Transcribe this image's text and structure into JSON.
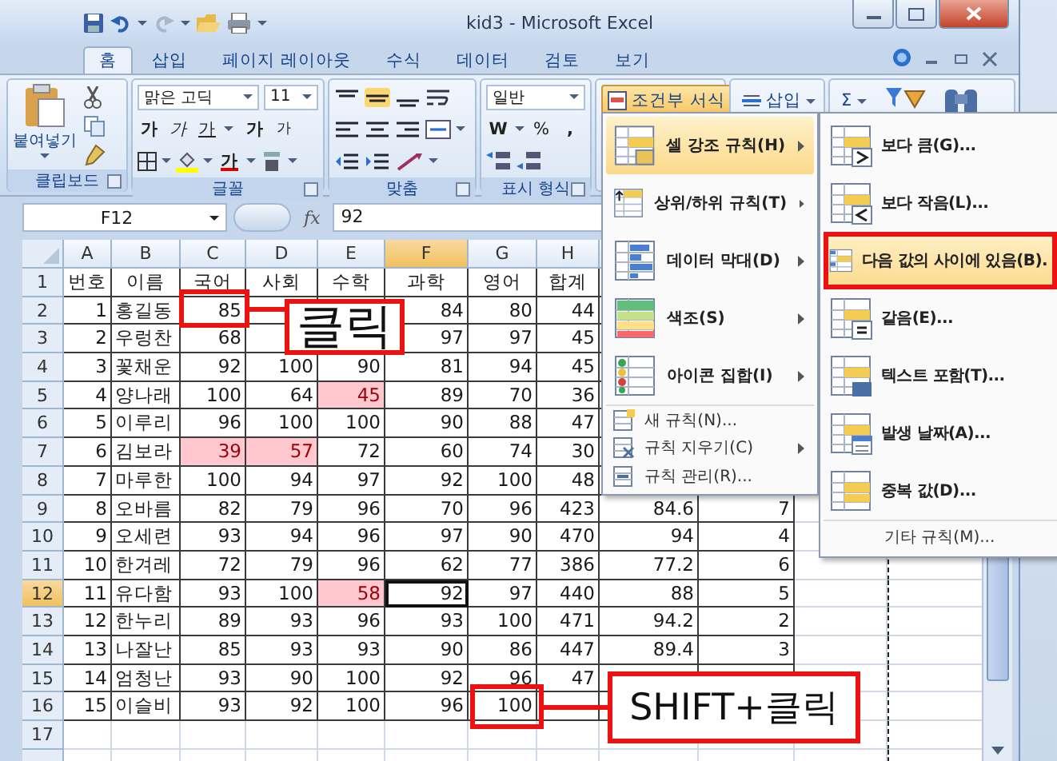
{
  "window": {
    "title": "kid3 - Microsoft Excel"
  },
  "tabs": [
    {
      "label": "홈",
      "selected": true
    },
    {
      "label": "삽입",
      "selected": false
    },
    {
      "label": "페이지 레이아웃",
      "selected": false
    },
    {
      "label": "수식",
      "selected": false
    },
    {
      "label": "데이터",
      "selected": false
    },
    {
      "label": "검토",
      "selected": false
    },
    {
      "label": "보기",
      "selected": false
    }
  ],
  "ribbon": {
    "clipboard": {
      "label": "클립보드",
      "paste": "붙여넣기"
    },
    "font": {
      "label": "글꼴",
      "family": "맑은 고딕",
      "size": "11",
      "bold": "가",
      "italic": "가",
      "underline": "가",
      "grow": "가",
      "shrink": "가",
      "text_color_button": "가"
    },
    "alignment": {
      "label": "맞춤"
    },
    "number": {
      "label": "표시 형식",
      "format": "일반",
      "currency": "W",
      "percent": "%",
      "comma": ","
    },
    "styles": {
      "conditional": "조건부 서식",
      "pressed": true
    },
    "cells": {
      "insert": "삽입"
    },
    "editing": {
      "sum": "Σ"
    }
  },
  "formula_bar": {
    "name_box": "F12",
    "fx": "fx",
    "value": "92"
  },
  "sheet": {
    "columns": [
      {
        "label": "A",
        "selected": false
      },
      {
        "label": "B",
        "selected": false
      },
      {
        "label": "C",
        "selected": false
      },
      {
        "label": "D",
        "selected": false
      },
      {
        "label": "E",
        "selected": false
      },
      {
        "label": "F",
        "selected": true
      },
      {
        "label": "G",
        "selected": false
      },
      {
        "label": "H",
        "selected": false
      }
    ],
    "rows": [
      {
        "header": "1",
        "selected": false,
        "kind": "heading",
        "cells": [
          "번호",
          "이름",
          "국어",
          "사회",
          "수학",
          "과학",
          "영어",
          "합계",
          null,
          null
        ]
      },
      {
        "header": "2",
        "selected": false,
        "kind": "data",
        "cells": [
          "1",
          "홍길동",
          "85",
          null,
          null,
          "84",
          "80",
          "44",
          null,
          null
        ]
      },
      {
        "header": "3",
        "selected": false,
        "kind": "data",
        "cells": [
          "2",
          "우렁찬",
          "68",
          null,
          null,
          "97",
          "97",
          "45",
          null,
          null
        ]
      },
      {
        "header": "4",
        "selected": false,
        "kind": "data",
        "cells": [
          "3",
          "꽃채운",
          "92",
          "100",
          "90",
          "81",
          "94",
          "45",
          null,
          null
        ]
      },
      {
        "header": "5",
        "selected": false,
        "kind": "data",
        "cells": [
          "4",
          "양나래",
          "100",
          "64",
          {
            "text": "45",
            "highlighted": true
          },
          "89",
          "70",
          "36",
          null,
          null
        ]
      },
      {
        "header": "6",
        "selected": false,
        "kind": "data",
        "cells": [
          "5",
          "이루리",
          "96",
          "100",
          "100",
          "90",
          "88",
          "47",
          null,
          null
        ]
      },
      {
        "header": "7",
        "selected": false,
        "kind": "data",
        "cells": [
          "6",
          "김보라",
          {
            "text": "39",
            "highlighted": true
          },
          {
            "text": "57",
            "highlighted": true
          },
          "72",
          "60",
          "74",
          "30",
          null,
          null
        ]
      },
      {
        "header": "8",
        "selected": false,
        "kind": "data",
        "cells": [
          "7",
          "마루한",
          "100",
          "94",
          "97",
          "92",
          "100",
          "48",
          null,
          null
        ]
      },
      {
        "header": "9",
        "selected": false,
        "kind": "data",
        "cells": [
          "8",
          "오바름",
          "82",
          "79",
          "96",
          "70",
          "96",
          "423",
          "84.6",
          "7"
        ]
      },
      {
        "header": "10",
        "selected": false,
        "kind": "data",
        "cells": [
          "9",
          "오세련",
          "93",
          "94",
          "96",
          "97",
          "90",
          "470",
          "94",
          "4"
        ]
      },
      {
        "header": "11",
        "selected": false,
        "kind": "data",
        "cells": [
          "10",
          "한겨레",
          "72",
          "79",
          "96",
          "62",
          "77",
          "386",
          "77.2",
          "6"
        ]
      },
      {
        "header": "12",
        "selected": true,
        "kind": "data",
        "cells": [
          "11",
          "유다함",
          "93",
          "100",
          {
            "text": "58",
            "highlighted": true
          },
          {
            "text": "92",
            "active": true
          },
          "97",
          "440",
          "88",
          "5"
        ]
      },
      {
        "header": "13",
        "selected": false,
        "kind": "data",
        "cells": [
          "12",
          "한누리",
          "89",
          "93",
          "96",
          "93",
          "100",
          "471",
          "94.2",
          "2"
        ]
      },
      {
        "header": "14",
        "selected": false,
        "kind": "data",
        "cells": [
          "13",
          "나잘난",
          "85",
          "93",
          "93",
          "90",
          "86",
          "447",
          "89.4",
          "3"
        ]
      },
      {
        "header": "15",
        "selected": false,
        "kind": "data",
        "cells": [
          "14",
          "엄청난",
          "93",
          "90",
          "100",
          "92",
          "96",
          "47",
          null,
          null
        ]
      },
      {
        "header": "16",
        "selected": false,
        "kind": "data",
        "cells": [
          "15",
          "이슬비",
          "93",
          "92",
          "100",
          "96",
          "100",
          null,
          null,
          null
        ]
      },
      {
        "header": "17",
        "selected": false,
        "kind": "empty"
      }
    ]
  },
  "menu": {
    "items": [
      {
        "label": "셀 강조 규칙(H)",
        "kind": "large",
        "selected": true,
        "has_submenu": true
      },
      {
        "label": "상위/하위 규칙(T)",
        "kind": "large",
        "selected": false,
        "has_submenu": true
      },
      {
        "label": "데이터 막대(D)",
        "kind": "large",
        "selected": false,
        "has_submenu": true
      },
      {
        "label": "색조(S)",
        "kind": "large",
        "selected": false,
        "has_submenu": true
      },
      {
        "label": "아이콘 집합(I)",
        "kind": "large",
        "selected": false,
        "has_submenu": true
      },
      {
        "label": "새 규칙(N)...",
        "kind": "small",
        "selected": false,
        "has_submenu": false
      },
      {
        "label": "규칙 지우기(C)",
        "kind": "small",
        "selected": false,
        "has_submenu": true
      },
      {
        "label": "규칙 관리(R)...",
        "kind": "small",
        "selected": false,
        "has_submenu": false
      }
    ]
  },
  "submenu": {
    "items": [
      {
        "label": "보다 큼(G)...",
        "kind": "large",
        "selected": false
      },
      {
        "label": "보다 작음(L)...",
        "kind": "large",
        "selected": false
      },
      {
        "label": "다음 값의 사이에 있음(B).",
        "kind": "large",
        "selected": true
      },
      {
        "label": "같음(E)...",
        "kind": "large",
        "selected": false
      },
      {
        "label": "텍스트 포함(T)...",
        "kind": "large",
        "selected": false
      },
      {
        "label": "발생 날짜(A)...",
        "kind": "large",
        "selected": false
      },
      {
        "label": "중복 값(D)...",
        "kind": "large",
        "selected": false
      },
      {
        "label": "기타 규칙(M)...",
        "kind": "small",
        "selected": false
      }
    ]
  },
  "callouts": [
    {
      "text": "클릭"
    },
    {
      "text": "SHIFT+클릭"
    }
  ]
}
